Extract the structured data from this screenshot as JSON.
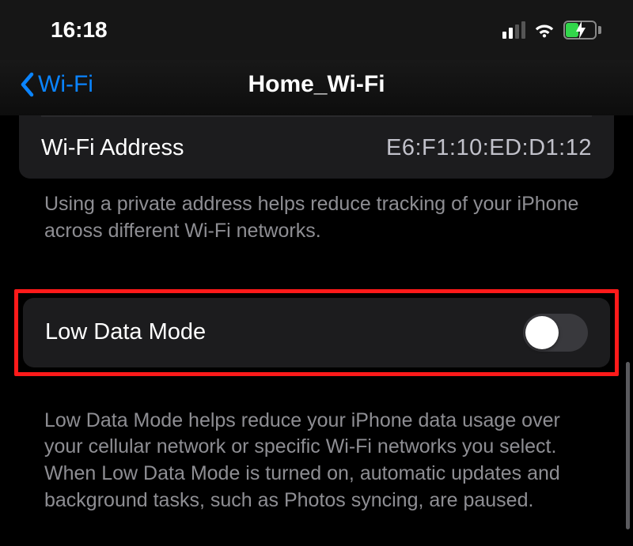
{
  "status": {
    "time": "16:18"
  },
  "nav": {
    "back_label": "Wi-Fi",
    "title": "Home_Wi-Fi"
  },
  "wifi_address": {
    "label": "Wi-Fi Address",
    "value": "E6:F1:10:ED:D1:12"
  },
  "private_address_footer": "Using a private address helps reduce tracking of your iPhone across different Wi-Fi networks.",
  "low_data_mode": {
    "label": "Low Data Mode",
    "enabled": false
  },
  "low_data_footer": "Low Data Mode helps reduce your iPhone data usage over your cellular network or specific Wi-Fi networks you select. When Low Data Mode is turned on, automatic updates and background tasks, such as Photos syncing, are paused."
}
